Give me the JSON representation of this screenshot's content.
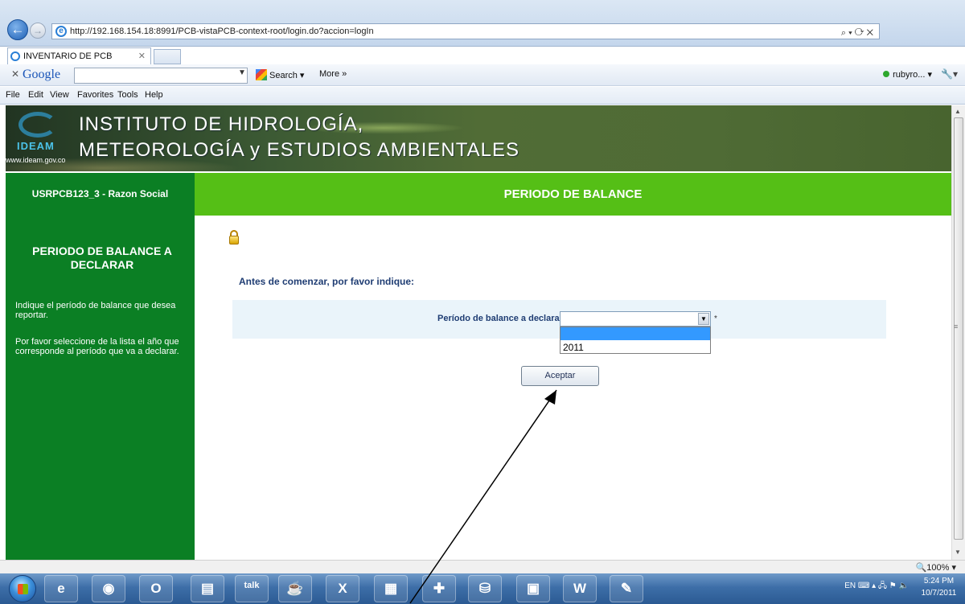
{
  "browser": {
    "address": "http://192.168.154.18:8991/PCB-vistaPCB-context-root/login.do?accion=logIn",
    "address_tools": "⌕ ▾ ⟳ ✕",
    "tab_title": "INVENTARIO DE PCB",
    "tab_close": "✕",
    "google_toolbar": {
      "close": "✕",
      "logo": "Google",
      "search_label": "Search",
      "more_label": "More »",
      "user": "rubyro... ▾",
      "wrench": "🔧▾"
    },
    "menu": [
      "File",
      "Edit",
      "View",
      "Favorites",
      "Tools",
      "Help"
    ],
    "zoom": "🔍100%  ▾"
  },
  "page": {
    "banner": {
      "logo_word": "IDEAM",
      "logo_url": "www.ideam.gov.co",
      "title_line1": "INSTITUTO DE HIDROLOGÍA,",
      "title_line2": "METEOROLOGÍA y ESTUDIOS AMBIENTALES"
    },
    "user_label": "USRPCB123_3 - Razon Social",
    "section_title": "PERIODO DE BALANCE",
    "sidebar": {
      "title": "PERIODO DE BALANCE A DECLARAR",
      "help1": "Indique el período de balance que desea reportar.",
      "help2": "Por favor seleccione de la lista el año que corresponde al período que va a declarar."
    },
    "form": {
      "heading": "Antes de comenzar, por favor indique:",
      "period_label": "Período de balance a declarar",
      "period_value": "",
      "required_mark": "*",
      "options": [
        "",
        "2011"
      ],
      "accept_label": "Aceptar"
    }
  },
  "taskbar": {
    "apps": [
      "ie-icon",
      "chrome-icon",
      "outlook-icon",
      "explorer-icon",
      "talk-icon",
      "java-icon",
      "excel-icon",
      "calculator-icon",
      "app-icon",
      "database-icon",
      "access-icon",
      "word-icon",
      "paint-icon"
    ],
    "tray": "EN ⌨ ▴ 🖧 ⚑ 🔈",
    "clock_time": "5:24 PM",
    "clock_date": "10/7/2011"
  },
  "colors": {
    "sidebar_green": "#0b7f24",
    "header_green": "#55bf16",
    "form_band": "#eaf4fa",
    "heading_blue": "#1f3d73",
    "selection_blue": "#3399ff"
  }
}
